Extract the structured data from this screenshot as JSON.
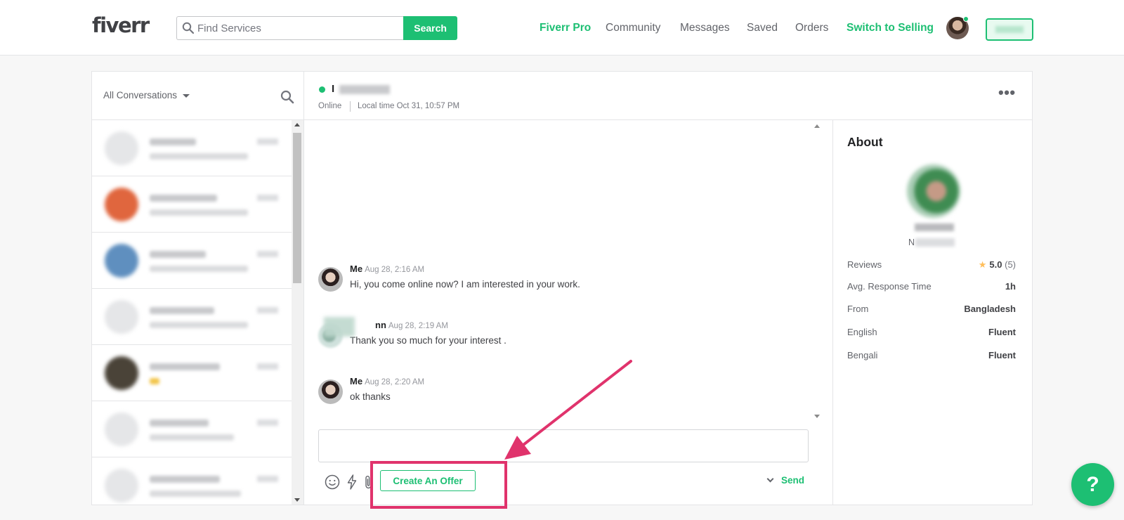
{
  "header": {
    "logo": "fiverr",
    "search_placeholder": "Find Services",
    "search_button": "Search",
    "nav": [
      "Fiverr Pro",
      "Community",
      "Messages",
      "Saved",
      "Orders",
      "Switch to Selling"
    ],
    "accent_color": "#1dbf73"
  },
  "sidebar": {
    "filter_label": "All Conversations",
    "conversations_count_visible": 7
  },
  "chat": {
    "user_initial": "I",
    "status": "Online",
    "local_time": "Local time Oct 31, 10:57 PM",
    "more_icon": "more-dots-icon",
    "messages": [
      {
        "sender": "Me",
        "date": "Aug 28, 2:16 AM",
        "text": "Hi, you come online now? I am interested in your work."
      },
      {
        "sender": "nn",
        "date": "Aug 28, 2:19 AM",
        "text": "Thank you so much for your interest ."
      },
      {
        "sender": "Me",
        "date": "Aug 28, 2:20 AM",
        "text": "ok thanks"
      }
    ],
    "create_offer_button": "Create An Offer",
    "send_button": "Send"
  },
  "about": {
    "title": "About",
    "subtitle_initial": "N",
    "rows": [
      {
        "label": "Reviews",
        "rating": "5.0",
        "count": "(5)"
      },
      {
        "label": "Avg. Response Time",
        "value": "1h"
      },
      {
        "label": "From",
        "value": "Bangladesh"
      },
      {
        "label": "English",
        "value": "Fluent"
      },
      {
        "label": "Bengali",
        "value": "Fluent"
      }
    ]
  },
  "help_button": "?",
  "annotation_color": "#e0336c"
}
